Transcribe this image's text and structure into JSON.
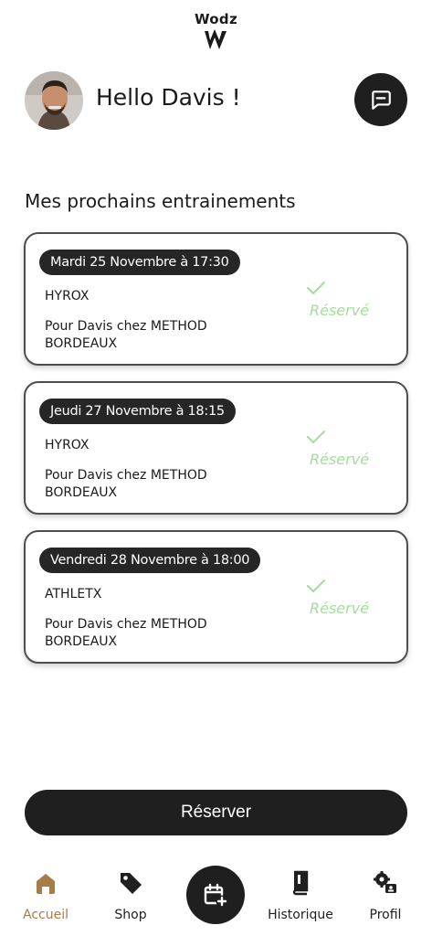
{
  "app": {
    "brand_name": "Wodz"
  },
  "header": {
    "greeting": "Hello Davis !"
  },
  "section": {
    "title": "Mes prochains entrainements"
  },
  "sessions": [
    {
      "date": "Mardi 25 Novembre à 17:30",
      "activity": "HYROX",
      "description": "Pour Davis chez METHOD BORDEAUX",
      "status": "Réservé"
    },
    {
      "date": "Jeudi 27 Novembre à 18:15",
      "activity": "HYROX",
      "description": "Pour Davis chez METHOD BORDEAUX",
      "status": "Réservé"
    },
    {
      "date": "Vendredi 28 Novembre à 18:00",
      "activity": "ATHLETX",
      "description": "Pour Davis chez METHOD BORDEAUX",
      "status": "Réservé"
    }
  ],
  "actions": {
    "reserve_label": "Réserver"
  },
  "nav": {
    "items": [
      {
        "label": "Accueil",
        "icon": "home-icon",
        "active": true
      },
      {
        "label": "Shop",
        "icon": "tag-icon",
        "active": false
      },
      {
        "label": "",
        "icon": "calendar-add-icon",
        "active": false
      },
      {
        "label": "Historique",
        "icon": "book-icon",
        "active": false
      },
      {
        "label": "Profil",
        "icon": "user-settings-icon",
        "active": false
      }
    ]
  },
  "colors": {
    "accent": "#a67c48",
    "status_green": "#a4dd9c",
    "dark": "#1f1f1f"
  }
}
